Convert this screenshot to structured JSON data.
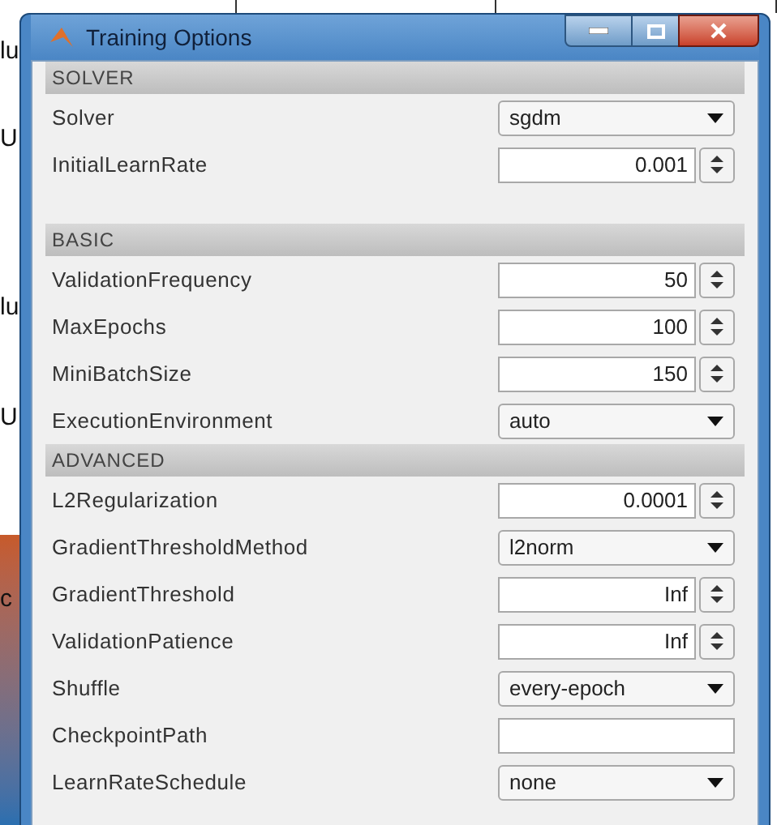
{
  "background_fragments": [
    "lu",
    "U",
    "lu",
    "U",
    "c"
  ],
  "window": {
    "title": "Training Options"
  },
  "sections": [
    {
      "title": "SOLVER",
      "rows": [
        {
          "label": "Solver",
          "kind": "dropdown",
          "value": "sgdm"
        },
        {
          "label": "InitialLearnRate",
          "kind": "spinner",
          "value": "0.001"
        }
      ]
    },
    {
      "title": "BASIC",
      "rows": [
        {
          "label": "ValidationFrequency",
          "kind": "spinner",
          "value": "50"
        },
        {
          "label": "MaxEpochs",
          "kind": "spinner",
          "value": "100"
        },
        {
          "label": "MiniBatchSize",
          "kind": "spinner",
          "value": "150"
        },
        {
          "label": "ExecutionEnvironment",
          "kind": "dropdown",
          "value": "auto"
        }
      ]
    },
    {
      "title": "ADVANCED",
      "rows": [
        {
          "label": "L2Regularization",
          "kind": "spinner",
          "value": "0.0001"
        },
        {
          "label": "GradientThresholdMethod",
          "kind": "dropdown",
          "value": "l2norm"
        },
        {
          "label": "GradientThreshold",
          "kind": "spinner",
          "value": "Inf"
        },
        {
          "label": "ValidationPatience",
          "kind": "spinner",
          "value": "Inf"
        },
        {
          "label": "Shuffle",
          "kind": "dropdown",
          "value": "every-epoch"
        },
        {
          "label": "CheckpointPath",
          "kind": "text"
        },
        {
          "label": "LearnRateSchedule",
          "kind": "dropdown",
          "value": "none"
        }
      ]
    }
  ]
}
